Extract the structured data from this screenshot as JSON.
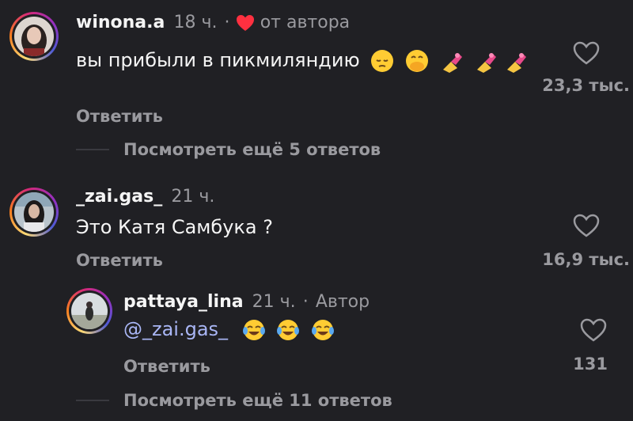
{
  "colors": {
    "background": "#202024",
    "text": "#f5f5f5",
    "muted": "#9a9a9f",
    "mention": "#a9b6f5",
    "heart": "#ff3040"
  },
  "comments": [
    {
      "username": "winona.a",
      "time": "18 ч.",
      "separator": "·",
      "author_badge": "от автора",
      "text": "вы прибыли в пикмиляндию",
      "emojis": [
        "pensive-face",
        "hand-over-mouth-face",
        "nail-polish",
        "nail-polish",
        "nail-polish"
      ],
      "reply_label": "Ответить",
      "likes": "23,3 тыс.",
      "more_replies": "Посмотреть ещё 5 ответов"
    },
    {
      "username": "_zai.gas_",
      "time": "21 ч.",
      "text": "Это Катя Самбука ?",
      "reply_label": "Ответить",
      "likes": "16,9 тыс.",
      "replies": [
        {
          "username": "pattaya_lina",
          "time": "21 ч.",
          "separator": "·",
          "author_badge": "Автор",
          "mention": "@_zai.gas_",
          "emojis": [
            "tears-of-joy-face",
            "tears-of-joy-face",
            "tears-of-joy-face"
          ],
          "reply_label": "Ответить",
          "likes": "131"
        }
      ],
      "more_replies": "Посмотреть ещё 11 ответов"
    }
  ]
}
